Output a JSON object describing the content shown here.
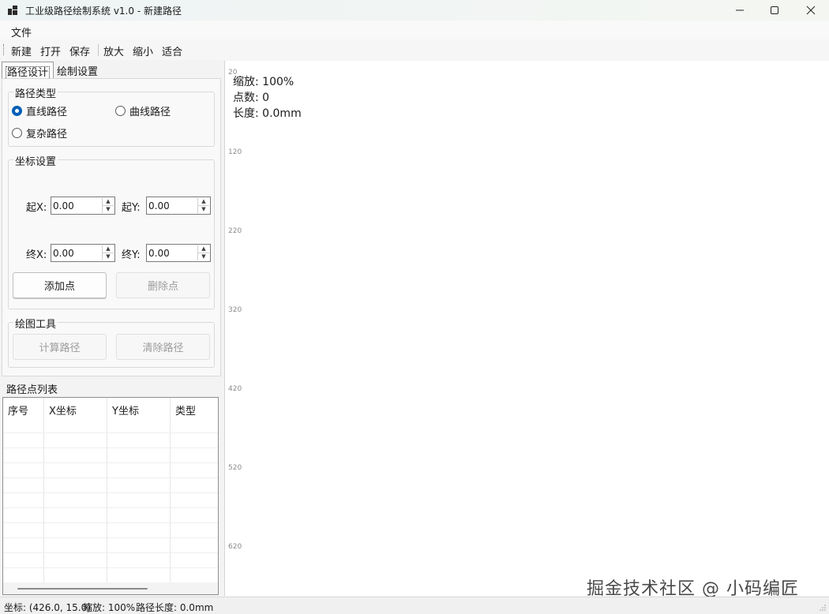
{
  "window": {
    "title": "工业级路径绘制系统 v1.0 - 新建路径"
  },
  "menu": {
    "items": [
      "文件"
    ]
  },
  "toolbar": {
    "new": "新建",
    "open": "打开",
    "save": "保存",
    "zoom_in": "放大",
    "zoom_out": "缩小",
    "fit": "适合"
  },
  "tabs": [
    "路径设计",
    "绘制设置"
  ],
  "path_type": {
    "title": "路径类型",
    "options": [
      "直线路径",
      "曲线路径",
      "复杂路径"
    ],
    "selected": "直线路径"
  },
  "coords": {
    "title": "坐标设置",
    "start_x_label": "起X:",
    "start_x": "0.00",
    "start_y_label": "起Y:",
    "start_y": "0.00",
    "end_x_label": "终X:",
    "end_x": "0.00",
    "end_y_label": "终Y:",
    "end_y": "0.00",
    "add_button": "添加点",
    "delete_button": "删除点"
  },
  "tools": {
    "title": "绘图工具",
    "calc_button": "计算路径",
    "clear_button": "清除路径"
  },
  "point_list": {
    "title": "路径点列表",
    "columns": [
      "序号",
      "X坐标",
      "Y坐标",
      "类型"
    ]
  },
  "canvas": {
    "zoom_info": "缩放: 100%",
    "points_info": "点数: 0",
    "length_info": "长度: 0.0mm",
    "y_ticks": [
      "20",
      "120",
      "220",
      "320",
      "420",
      "520",
      "620"
    ]
  },
  "watermark": "掘金技术社区 @ 小码编匠",
  "status": {
    "coord": "坐标: (426.0, 15.0)",
    "zoom": "缩放: 100%",
    "length": "路径长度: 0.0mm"
  },
  "colors": {
    "accent": "#005fb8",
    "canvas_bg": "#ffffff",
    "window_bg": "#f3f3f3"
  }
}
